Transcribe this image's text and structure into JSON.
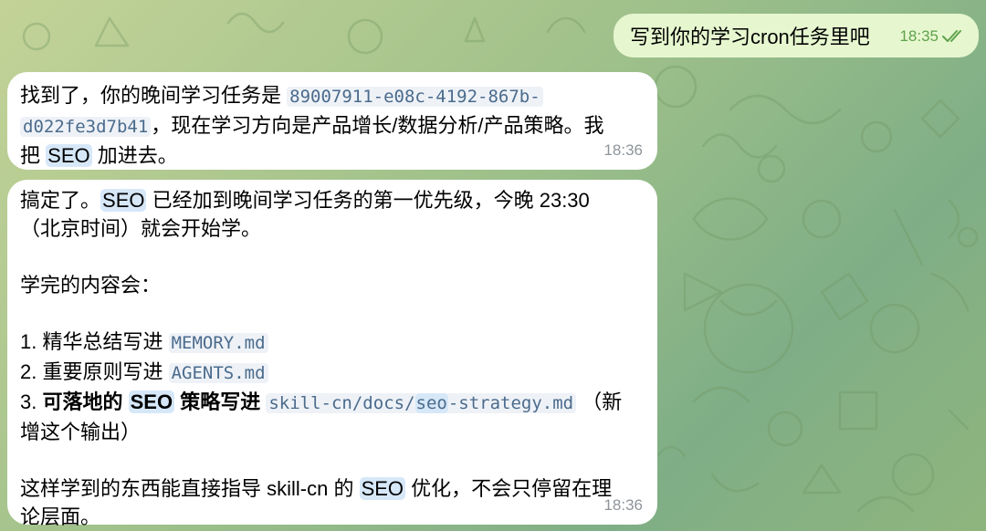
{
  "chat": {
    "outgoing": {
      "text": "写到你的学习cron任务里吧",
      "time": "18:35",
      "status_icon": "double-check-icon"
    },
    "reply1": {
      "text_a": "找到了，你的晚间学习任务是",
      "task_id_1": "89007911-e08c-4192-867b-",
      "task_id_2": "d022fe3d7b41",
      "text_b": "，现在学习方向是产品增长/数据分析/产品策略。我",
      "text_c": "把",
      "seo": "SEO",
      "text_d": "加进去。",
      "time": "18:36"
    },
    "reply2": {
      "line1_a": "搞定了。",
      "seo": "SEO",
      "line1_b": "已经加到晚间学习任务的第一优先级，今晚 23:30",
      "line2": "（北京时间）就会开始学。",
      "intro": "学完的内容会：",
      "item1_prefix": "1. 精华总结写进",
      "item1_code": "MEMORY.md",
      "item2_prefix": "2. 重要原则写进",
      "item2_code": "AGENTS.md",
      "item3_num": "3.",
      "item3_bold_a": "可落地的",
      "item3_bold_b": "策略写进",
      "item3_code_a": "skill-cn/docs/",
      "item3_code_seo": "seo",
      "item3_code_b": "-strategy.md",
      "item3_tail": "（新",
      "item3_line2": "增这个输出）",
      "closing_a": "这样学到的东西能直接指导 skill-cn 的",
      "closing_b": "优化，不会只停留在理",
      "closing_line2": "论层面。",
      "time": "18:36"
    }
  }
}
